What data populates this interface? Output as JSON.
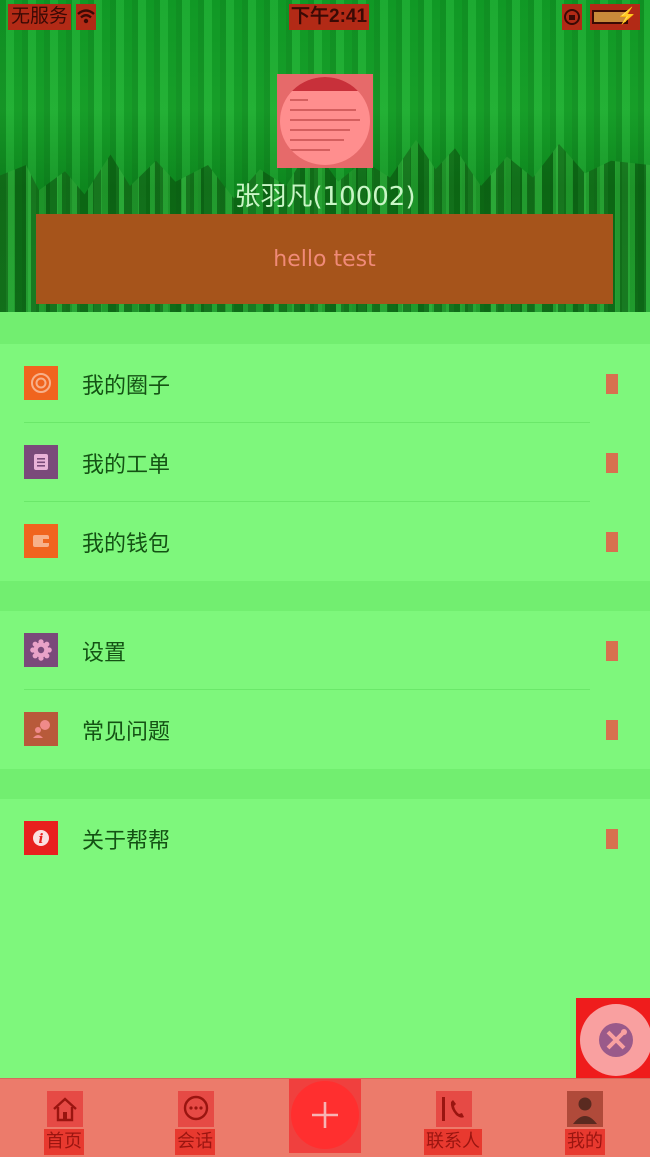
{
  "status_bar": {
    "carrier": "无服务",
    "time": "下午2:41"
  },
  "profile": {
    "name": "张羽凡(10002)",
    "signature": "hello test"
  },
  "menu": {
    "group1": [
      {
        "label": "我的圈子",
        "icon": "circle-icon",
        "color": "#f0641e"
      },
      {
        "label": "我的工单",
        "icon": "document-icon",
        "color": "#7a4a7a"
      },
      {
        "label": "我的钱包",
        "icon": "wallet-icon",
        "color": "#f0641e"
      }
    ],
    "group2": [
      {
        "label": "设置",
        "icon": "gear-icon",
        "color": "#7a4a7a"
      },
      {
        "label": "常见问题",
        "icon": "question-icon",
        "color": "#b85a3a"
      }
    ],
    "group3": [
      {
        "label": "关于帮帮",
        "icon": "info-icon",
        "color": "#e8201e"
      }
    ]
  },
  "tabbar": {
    "home": "首页",
    "chat": "会话",
    "contacts": "联系人",
    "mine": "我的"
  },
  "colors": {
    "header_green": "#12a12a",
    "page_green": "#7ef77c",
    "tabbar": "#ec7b6b"
  }
}
